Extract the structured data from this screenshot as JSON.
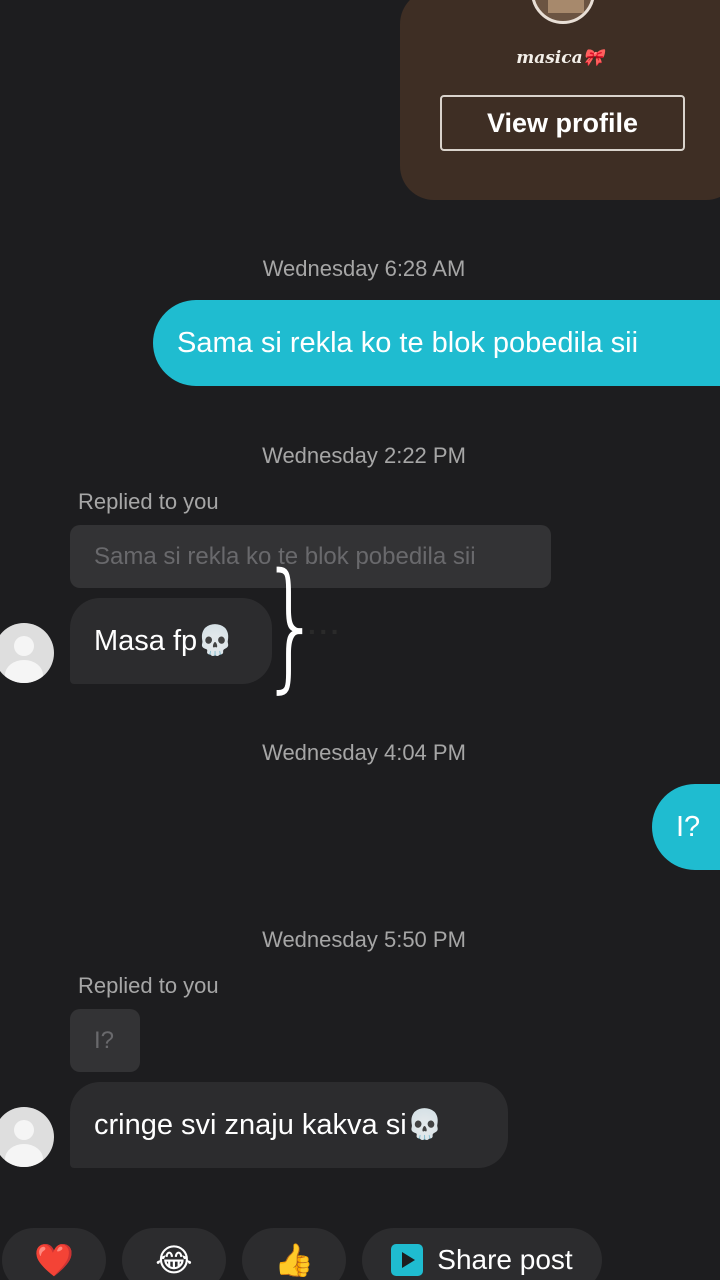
{
  "profile": {
    "name": "masica🎀",
    "view_profile_label": "View profile"
  },
  "messages": [
    {
      "type": "timestamp",
      "text": "Wednesday 6:28 AM"
    },
    {
      "type": "outgoing",
      "text": "Sama si rekla ko te blok pobedila sii"
    },
    {
      "type": "timestamp",
      "text": "Wednesday 2:22 PM"
    },
    {
      "type": "reply_label",
      "text": "Replied to you"
    },
    {
      "type": "quoted",
      "text": "Sama si rekla ko te blok pobedila sii"
    },
    {
      "type": "incoming",
      "text": "Masa fp💀"
    },
    {
      "type": "timestamp",
      "text": "Wednesday 4:04 PM"
    },
    {
      "type": "outgoing",
      "text": "I?"
    },
    {
      "type": "timestamp",
      "text": "Wednesday 5:50 PM"
    },
    {
      "type": "reply_label",
      "text": "Replied to you"
    },
    {
      "type": "quoted",
      "text": "I?"
    },
    {
      "type": "incoming",
      "text": "cringe svi znaju kakva si💀"
    }
  ],
  "annotation": {
    "brace": "}",
    "more_dots": "···"
  },
  "reactions": {
    "heart": "❤️",
    "laugh": "😂",
    "thumbs_up": "👍",
    "share_label": "Share post"
  },
  "colors": {
    "background": "#1d1d1f",
    "outgoing_bubble": "#1fbcd0",
    "incoming_bubble": "#2c2c2e",
    "profile_card": "#3e2e24"
  }
}
